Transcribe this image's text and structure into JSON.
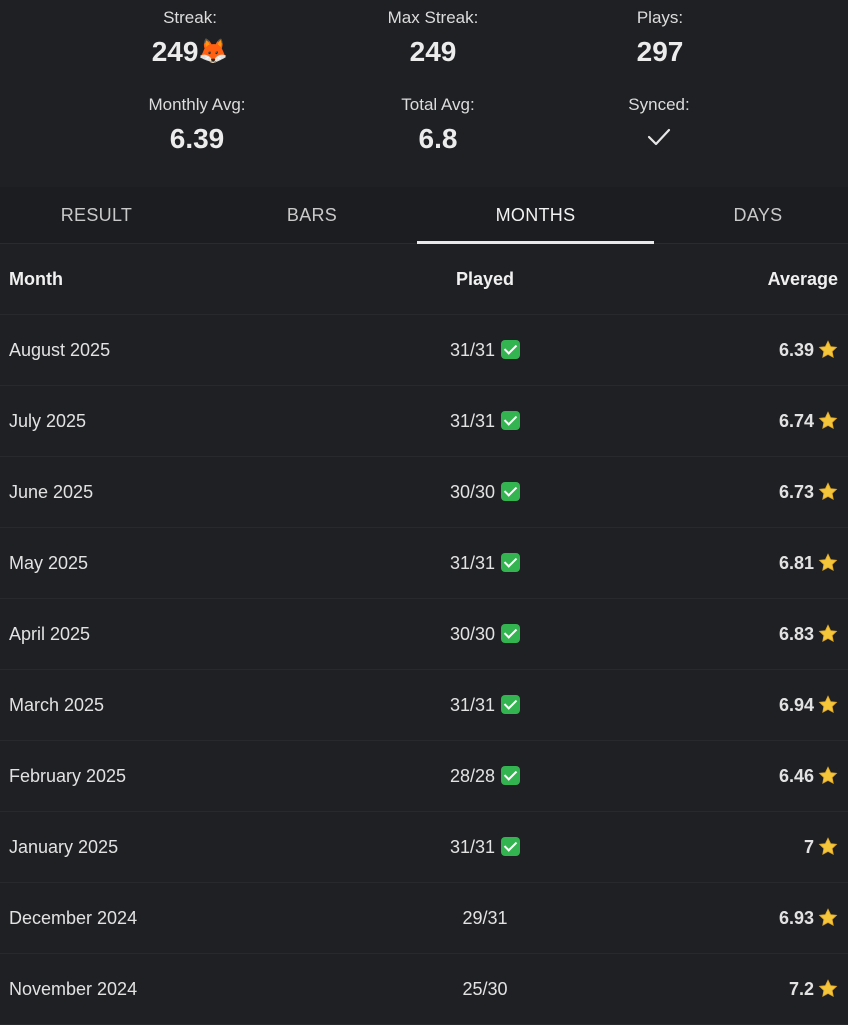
{
  "stats": {
    "streak": {
      "label": "Streak:",
      "value": "249",
      "emoji": "🦊"
    },
    "max_streak": {
      "label": "Max Streak:",
      "value": "249"
    },
    "plays": {
      "label": "Plays:",
      "value": "297"
    },
    "monthly_avg": {
      "label": "Monthly Avg:",
      "value": "6.39"
    },
    "total_avg": {
      "label": "Total Avg:",
      "value": "6.8"
    },
    "synced": {
      "label": "Synced:",
      "icon": "checkmark-icon"
    }
  },
  "tabs": [
    {
      "label": "RESULT"
    },
    {
      "label": "BARS"
    },
    {
      "label": "MONTHS",
      "active": true
    },
    {
      "label": "DAYS"
    }
  ],
  "table": {
    "headers": {
      "month": "Month",
      "played": "Played",
      "average": "Average"
    },
    "rows": [
      {
        "month": "August 2025",
        "played": "31/31",
        "complete": true,
        "average": "6.39"
      },
      {
        "month": "July 2025",
        "played": "31/31",
        "complete": true,
        "average": "6.74"
      },
      {
        "month": "June 2025",
        "played": "30/30",
        "complete": true,
        "average": "6.73"
      },
      {
        "month": "May 2025",
        "played": "31/31",
        "complete": true,
        "average": "6.81"
      },
      {
        "month": "April 2025",
        "played": "30/30",
        "complete": true,
        "average": "6.83"
      },
      {
        "month": "March 2025",
        "played": "31/31",
        "complete": true,
        "average": "6.94"
      },
      {
        "month": "February 2025",
        "played": "28/28",
        "complete": true,
        "average": "6.46"
      },
      {
        "month": "January 2025",
        "played": "31/31",
        "complete": true,
        "average": "7"
      },
      {
        "month": "December 2024",
        "played": "29/31",
        "complete": false,
        "average": "6.93"
      },
      {
        "month": "November 2024",
        "played": "25/30",
        "complete": false,
        "average": "7.2"
      }
    ]
  },
  "colors": {
    "background": "#1f2023",
    "check_badge": "#34b450",
    "star": "#f5c53a"
  }
}
